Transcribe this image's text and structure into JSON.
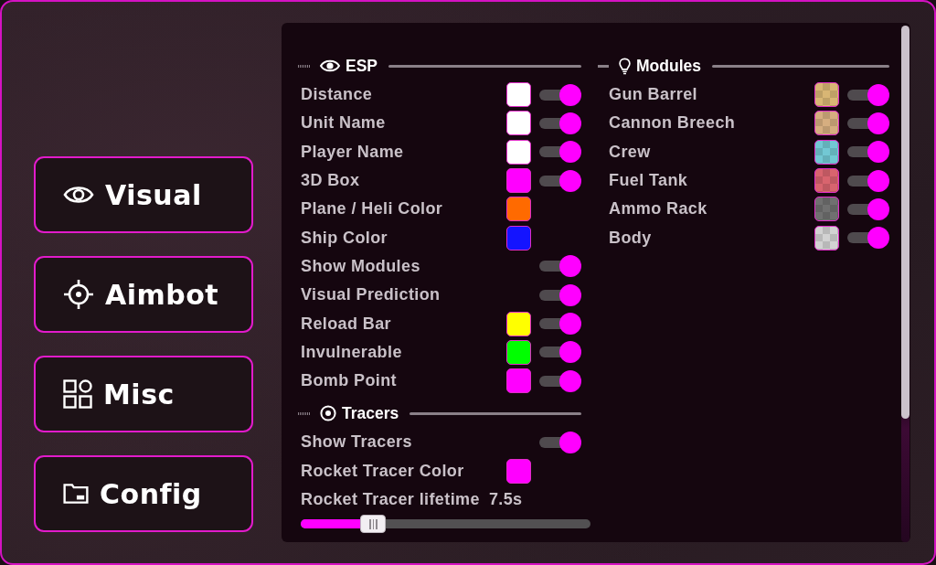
{
  "menu": [
    {
      "label": "Visual"
    },
    {
      "label": "Aimbot"
    },
    {
      "label": "Misc"
    },
    {
      "label": "Config"
    }
  ],
  "esp": {
    "title": "ESP",
    "items": [
      {
        "kind": "color-toggle",
        "label": "Distance",
        "color": "#ffffff",
        "on": true
      },
      {
        "kind": "color-toggle",
        "label": "Unit Name",
        "color": "#ffffff",
        "on": true
      },
      {
        "kind": "color-toggle",
        "label": "Player Name",
        "color": "#ffffff",
        "on": true
      },
      {
        "kind": "color-toggle",
        "label": "3D Box",
        "color": "#ff00ff",
        "on": true
      },
      {
        "kind": "color",
        "label": "Plane / Heli Color",
        "color": "#ff6a00"
      },
      {
        "kind": "color",
        "label": "Ship Color",
        "color": "#1414ff"
      },
      {
        "kind": "toggle",
        "label": "Show Modules",
        "on": true
      },
      {
        "kind": "toggle",
        "label": "Visual Prediction",
        "on": true
      },
      {
        "kind": "color-toggle",
        "label": "Reload Bar",
        "color": "#ffff00",
        "on": true
      },
      {
        "kind": "color-toggle",
        "label": "Invulnerable",
        "color": "#00ff00",
        "on": true
      },
      {
        "kind": "color-toggle",
        "label": "Bomb Point",
        "color": "#ff00ff",
        "on": true
      }
    ]
  },
  "tracers": {
    "title": "Tracers",
    "items": [
      {
        "kind": "toggle",
        "label": "Show Tracers",
        "on": true
      },
      {
        "kind": "color",
        "label": "Rocket Tracer Color",
        "color": "#ff00ff"
      },
      {
        "kind": "slider",
        "label": "Rocket Tracer lifetime",
        "reading": "7.5s",
        "level": 0.25
      }
    ]
  },
  "modules": {
    "title": "Modules",
    "items": [
      {
        "kind": "color-toggle",
        "label": "Gun Barrel",
        "color": "#d8b674",
        "on": true
      },
      {
        "kind": "color-toggle",
        "label": "Cannon Breech",
        "color": "#d6ae80",
        "on": true
      },
      {
        "kind": "color-toggle",
        "label": "Crew",
        "color": "#72c8d4",
        "on": true
      },
      {
        "kind": "color-toggle",
        "label": "Fuel Tank",
        "color": "#d8646e",
        "on": true
      },
      {
        "kind": "color-toggle",
        "label": "Ammo Rack",
        "color": "#707070",
        "on": true
      },
      {
        "kind": "color-toggle",
        "label": "Body",
        "color": "#d2d2d2",
        "on": true
      }
    ]
  }
}
